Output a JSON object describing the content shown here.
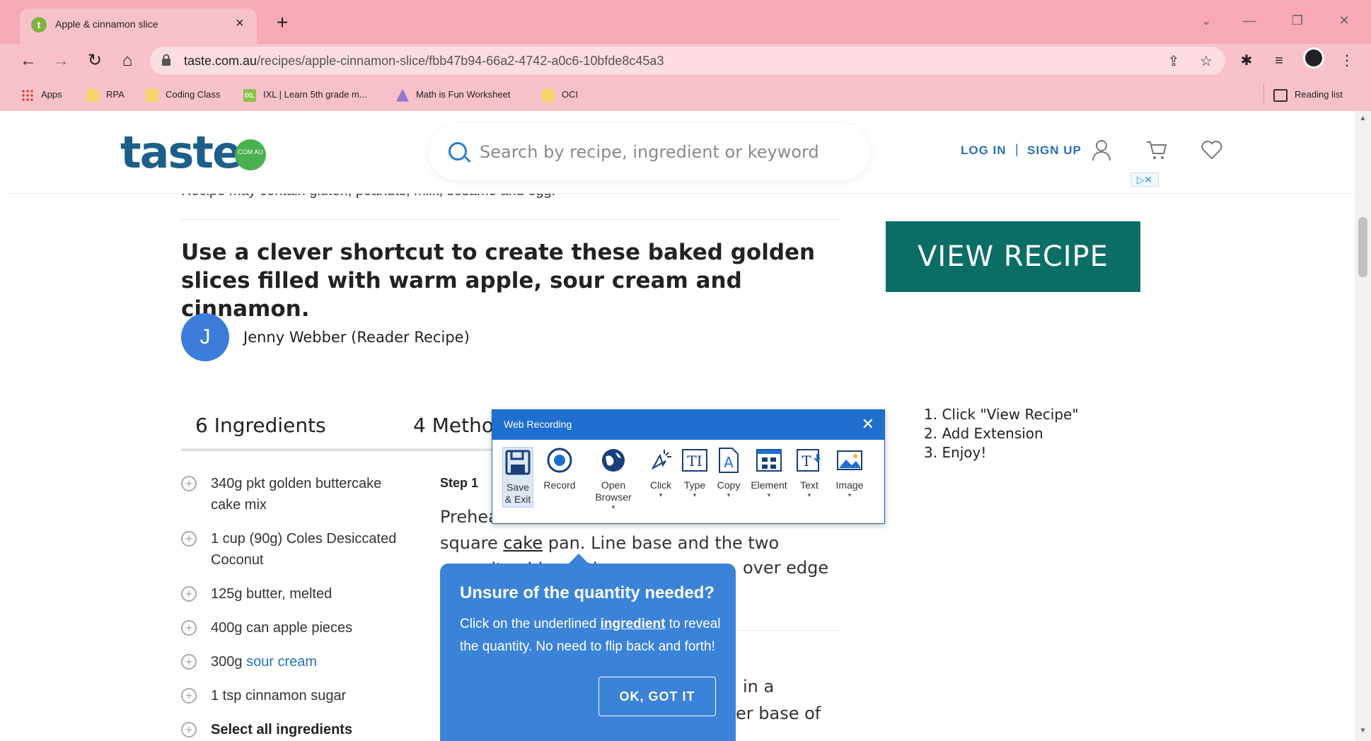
{
  "browser": {
    "tab_title": "Apple & cinnamon slice",
    "tab_favicon_letter": "t",
    "url_domain": "taste.com.au",
    "url_path": "/recipes/apple-cinnamon-slice/fbb47b94-66a2-4742-a0c6-10bfde8c45a3",
    "bookmarks": [
      {
        "label": "Apps",
        "icon": "apps-grid-icon"
      },
      {
        "label": "RPA",
        "icon": "folder-icon"
      },
      {
        "label": "Coding Class",
        "icon": "folder-icon"
      },
      {
        "label": "IXL | Learn 5th grade m...",
        "icon": "ixl-icon"
      },
      {
        "label": "Math is Fun Worksheet",
        "icon": "math-is-fun-icon"
      },
      {
        "label": "OCI",
        "icon": "folder-icon"
      }
    ],
    "reading_list": "Reading list",
    "colors": {
      "tabstrip": "#f7a9b6",
      "toolbar": "#f9c2cb"
    }
  },
  "site": {
    "logo": "taste",
    "logo_badge": "COM AU",
    "search_placeholder": "Search by recipe, ingredient or keyword",
    "login": "LOG IN",
    "separator": "|",
    "signup": "SIGN UP"
  },
  "recipe": {
    "allergen_fragment": "Recipe may contain gluten, peanuts, milk, sesame and egg.",
    "intro": "Use a clever shortcut to create these baked golden slices filled with warm apple, sour cream and cinnamon.",
    "author_initial": "J",
    "author_name": "Jenny Webber (Reader Recipe)",
    "tabs": {
      "ingredients": "6 Ingredients",
      "method": "4 Method Steps"
    },
    "ingredients": [
      {
        "text": "340g pkt golden buttercake cake mix"
      },
      {
        "text": "1 cup (90g) Coles Desiccated Coconut"
      },
      {
        "text": "125g butter, melted"
      },
      {
        "text": "400g can apple pieces"
      },
      {
        "prefix": "300g ",
        "link": "sour cream"
      },
      {
        "text": "1 tsp cinnamon sugar"
      },
      {
        "text": "Select all ingredients"
      }
    ],
    "step_label": "Step 1",
    "step_text_a": "Preheat the oven to 180°C. Grease a 20cm square ",
    "step_text_link": "cake",
    "step_text_b": " pan. Line base and the two opposite sides with",
    "step_frag_1": "over edge",
    "step_frag_2": "in a",
    "step_frag_3": "er base of"
  },
  "tooltip": {
    "title": "Unsure of the quantity needed?",
    "body_a": "Click on the underlined ",
    "body_link": "ingredient",
    "body_b": " to reveal the quantity. No need to flip back and forth!",
    "button": "OK, GOT IT"
  },
  "ad": {
    "button": "VIEW RECIPE",
    "steps": [
      "1. Click \"View Recipe\"",
      "2. Add Extension",
      "3. Enjoy!"
    ],
    "adchoices": "▷✕",
    "colors": {
      "button": "#0b6e66"
    }
  },
  "web_recording": {
    "title": "Web Recording",
    "tools": [
      {
        "label": "Save & Exit",
        "icon": "save-icon",
        "dropdown": false
      },
      {
        "label": "Record",
        "icon": "record-icon",
        "dropdown": false
      },
      {
        "label": "Open Browser",
        "icon": "globe-icon",
        "dropdown": true
      },
      {
        "label": "Click",
        "icon": "cursor-click-icon",
        "dropdown": true
      },
      {
        "label": "Type",
        "icon": "type-icon",
        "dropdown": true
      },
      {
        "label": "Copy",
        "icon": "copy-icon",
        "dropdown": true
      },
      {
        "label": "Element",
        "icon": "element-icon",
        "dropdown": true
      },
      {
        "label": "Text",
        "icon": "text-icon",
        "dropdown": true
      },
      {
        "label": "Image",
        "icon": "image-icon",
        "dropdown": true
      }
    ]
  }
}
